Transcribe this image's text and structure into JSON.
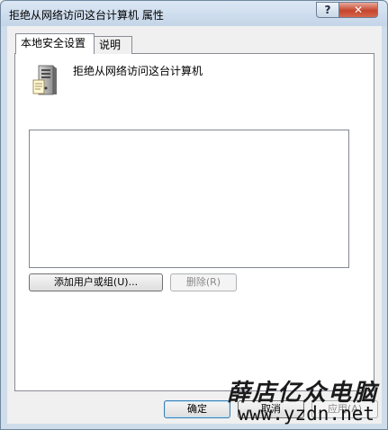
{
  "window": {
    "title": "拒绝从网络访问这台计算机 属性"
  },
  "caption_buttons": {
    "help": "?",
    "close": "✕"
  },
  "tabs": [
    {
      "label": "本地安全设置",
      "active": true
    },
    {
      "label": "说明",
      "active": false
    }
  ],
  "policy": {
    "name": "拒绝从网络访问这台计算机",
    "icon": "computer-tower-icon"
  },
  "user_list": {
    "items": []
  },
  "buttons": {
    "add": "添加用户或组(U)...",
    "remove": "删除(R)",
    "ok": "确定",
    "cancel": "取消",
    "apply": "应用(A)"
  },
  "watermark": {
    "brand": "薛店亿众电脑",
    "url": "www.yzdn.net"
  },
  "colors": {
    "titlebar": "#c4d5e8",
    "close": "#c4452c",
    "panel": "#ffffff"
  }
}
